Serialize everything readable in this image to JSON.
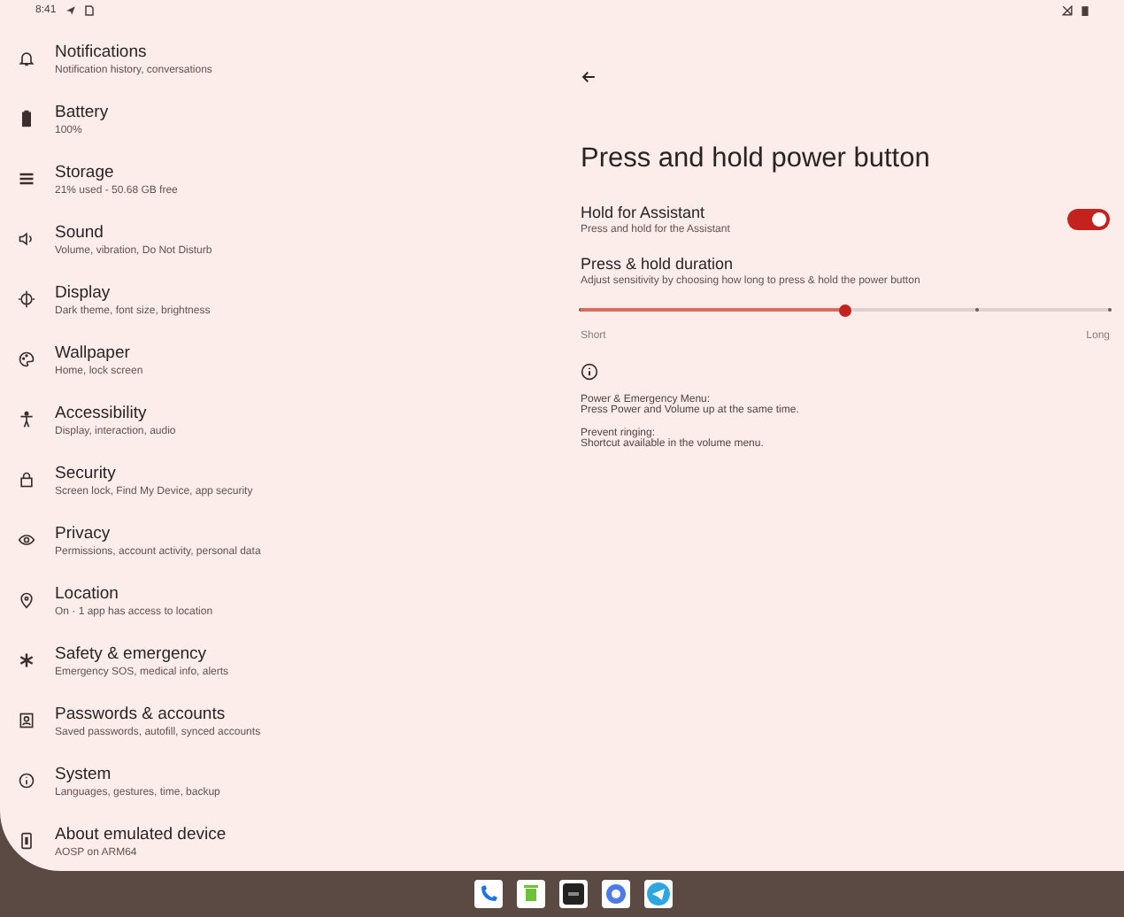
{
  "status_bar": {
    "time": "8:41"
  },
  "sidebar": {
    "items": [
      {
        "title": "Notifications",
        "subtitle": "Notification history, conversations"
      },
      {
        "title": "Battery",
        "subtitle": "100%"
      },
      {
        "title": "Storage",
        "subtitle": "21% used - 50.68 GB free"
      },
      {
        "title": "Sound",
        "subtitle": "Volume, vibration, Do Not Disturb"
      },
      {
        "title": "Display",
        "subtitle": "Dark theme, font size, brightness"
      },
      {
        "title": "Wallpaper",
        "subtitle": "Home, lock screen"
      },
      {
        "title": "Accessibility",
        "subtitle": "Display, interaction, audio"
      },
      {
        "title": "Security",
        "subtitle": "Screen lock, Find My Device, app security"
      },
      {
        "title": "Privacy",
        "subtitle": "Permissions, account activity, personal data"
      },
      {
        "title": "Location",
        "subtitle": "On · 1 app has access to location"
      },
      {
        "title": "Safety & emergency",
        "subtitle": "Emergency SOS, medical info, alerts"
      },
      {
        "title": "Passwords & accounts",
        "subtitle": "Saved passwords, autofill, synced accounts"
      },
      {
        "title": "System",
        "subtitle": "Languages, gestures, time, backup"
      },
      {
        "title": "About emulated device",
        "subtitle": "AOSP on ARM64"
      }
    ]
  },
  "detail": {
    "title": "Press and hold power button",
    "settings": [
      {
        "kind": "toggle",
        "title": "Hold for Assistant",
        "subtitle": "Press and hold for the Assistant",
        "on": true
      },
      {
        "kind": "slider",
        "title": "Press & hold duration",
        "subtitle": "Adjust sensitivity by choosing how long to press & hold the power button",
        "level": 0.5,
        "min_label": "Short",
        "max_label": "Long"
      }
    ],
    "notes": [
      {
        "title": "Power & Emergency Menu:",
        "text": "Press Power and Volume up at the same time."
      },
      {
        "title": "Prevent ringing:",
        "text": "Shortcut available in the volume menu."
      }
    ]
  }
}
